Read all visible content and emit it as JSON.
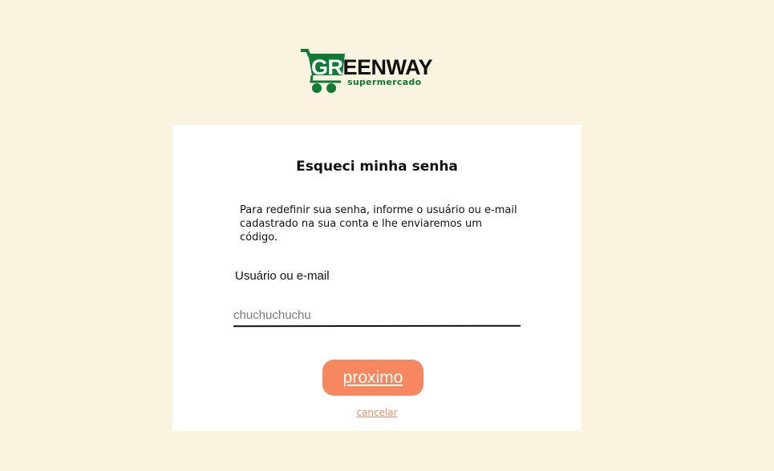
{
  "logo": {
    "brand_highlight": "GR",
    "brand_rest": "EENWAY",
    "tagline": "supermercado",
    "brand_color": "#0f7a34"
  },
  "card": {
    "title": "Esqueci minha senha",
    "description": "Para redefinir sua senha, informe o usuário ou e-mail cadastrado na sua conta e lhe enviaremos um código.",
    "field_label": "Usuário ou e-mail",
    "field_placeholder": "chuchuchuchu",
    "next_label": "proximo",
    "cancel_label": "cancelar"
  },
  "colors": {
    "background": "#faf3e0",
    "accent": "#f6875f",
    "link": "#f08a64"
  }
}
